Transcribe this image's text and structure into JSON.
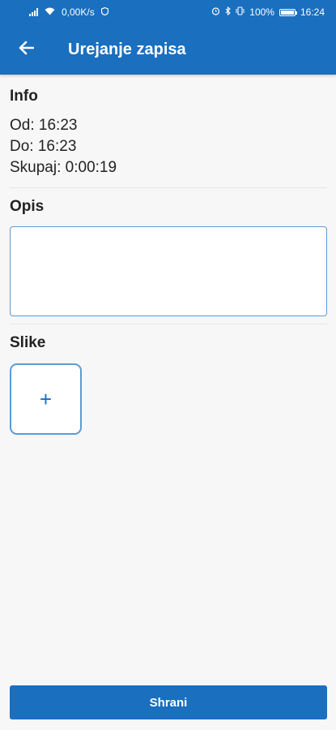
{
  "status_bar": {
    "speed": "0,00K/s",
    "battery": "100%",
    "time": "16:24"
  },
  "app_bar": {
    "title": "Urejanje zapisa"
  },
  "info": {
    "heading": "Info",
    "from": "Od: 16:23",
    "to": "Do: 16:23",
    "total": "Skupaj: 0:00:19"
  },
  "description": {
    "heading": "Opis",
    "value": ""
  },
  "images": {
    "heading": "Slike",
    "add_symbol": "+"
  },
  "actions": {
    "save_label": "Shrani"
  },
  "colors": {
    "primary": "#1a6fbf",
    "field_border": "#5b9bd5",
    "background": "#f7f7f8"
  }
}
